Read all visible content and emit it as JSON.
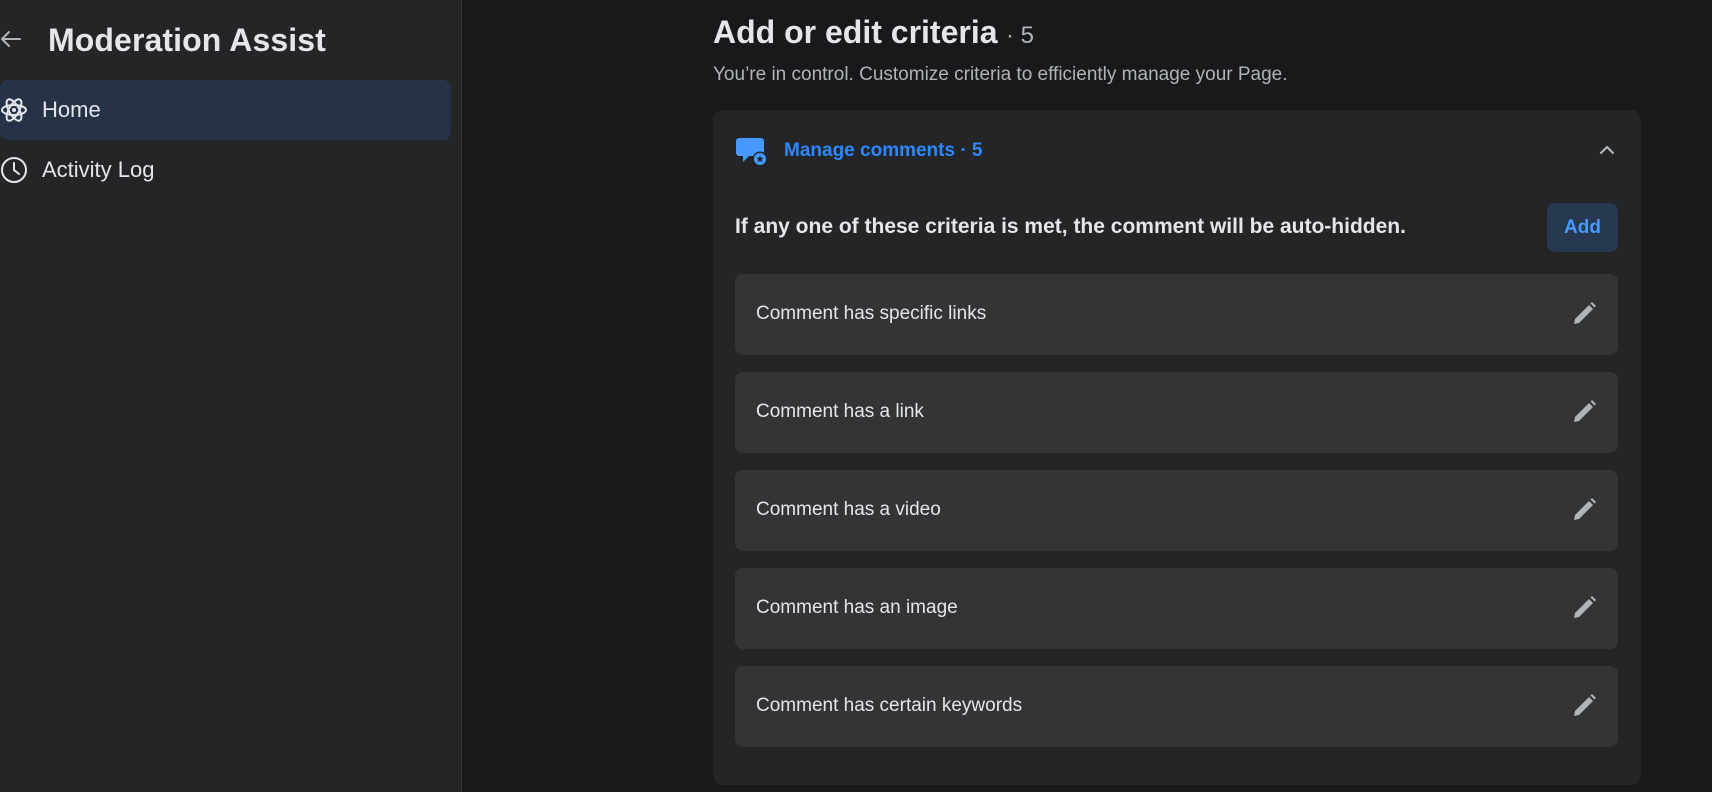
{
  "sidebar": {
    "title": "Moderation Assist",
    "items": [
      {
        "label": "Home",
        "icon": "atom-icon",
        "active": true
      },
      {
        "label": "Activity Log",
        "icon": "clock-icon",
        "active": false
      }
    ]
  },
  "main": {
    "title": "Add or edit criteria",
    "count": "· 5",
    "subtitle": "You’re in control. Customize criteria to efficiently manage your Page."
  },
  "section": {
    "label": "Manage comments · 5",
    "rule_text": "If any one of these criteria is met, the comment will be auto-hidden.",
    "add_label": "Add",
    "criteria": [
      "Comment has specific links",
      "Comment has a link",
      "Comment has a video",
      "Comment has an image",
      "Comment has certain keywords"
    ]
  },
  "colors": {
    "accent": "#2d88ff",
    "active_nav": "#263347",
    "add_button_bg": "#263951"
  }
}
